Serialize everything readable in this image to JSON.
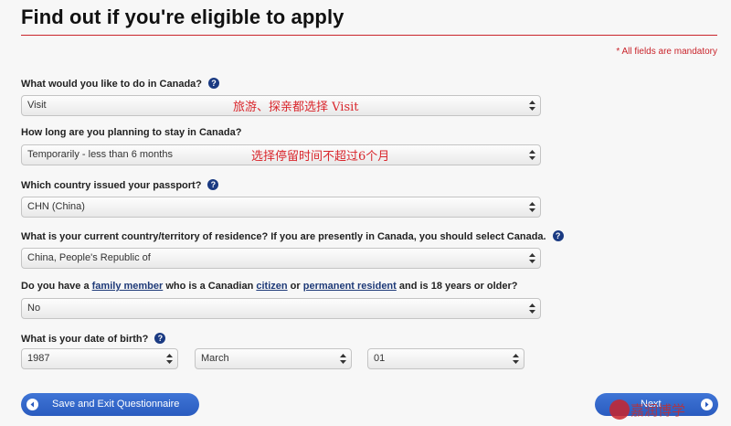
{
  "page": {
    "title": "Find out if you're eligible to apply",
    "mandatory_note": "* All fields are mandatory"
  },
  "questions": {
    "q1": {
      "label": "What would you like to do in Canada?",
      "value": "Visit",
      "note": "旅游、探亲都选择 Visit"
    },
    "q2": {
      "label": "How long are you planning to stay in Canada?",
      "value": "Temporarily - less than 6 months",
      "note": "选择停留时间不超过6个月"
    },
    "q3": {
      "label": "Which country issued your passport?",
      "value": "CHN (China)"
    },
    "q4": {
      "label": "What is your current country/territory of residence? If you are presently in Canada, you should select Canada.",
      "value": "China, People's Republic of"
    },
    "q5": {
      "label_pre": "Do you have a ",
      "link1": "family member",
      "label_mid1": " who is a Canadian ",
      "link2": "citizen",
      "label_mid2": " or ",
      "link3": "permanent resident",
      "label_post": " and is 18 years or older?",
      "value": "No"
    },
    "q6": {
      "label": "What is your date of birth?",
      "year": "1987",
      "month": "March",
      "day": "01"
    }
  },
  "help_icon": "?",
  "buttons": {
    "save_exit": "Save and Exit Questionnaire",
    "next": "Next"
  },
  "watermark": {
    "text": "嘉润博学"
  },
  "colors": {
    "accent_red": "#c9242b",
    "button_blue": "#2f62c8",
    "link_blue": "#1e3a78"
  }
}
